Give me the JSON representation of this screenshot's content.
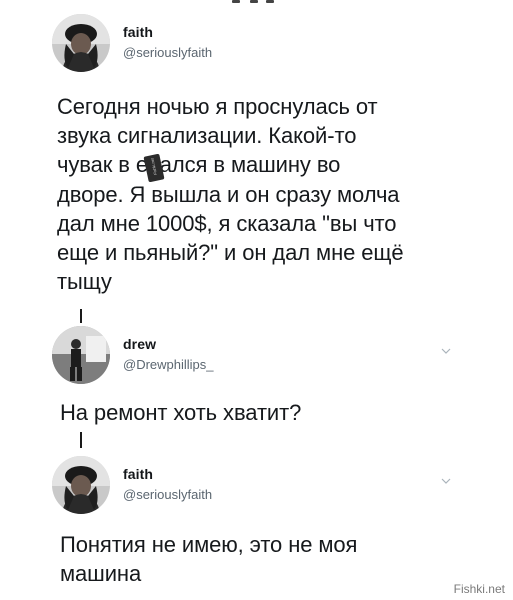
{
  "watermark": "Fishki.net",
  "censor_sticker": "Fishki.net",
  "tweets": [
    {
      "name": "faith",
      "handle": "@seriouslyfaith",
      "text": "Сегодня ночью я проснулась от\nзвука сигнализации. Какой-то\nчувак в ебался в машину во\nдворе. Я вышла и он сразу молча\nдал мне 1000$, я сказала \"вы что\nеще и пьяный?\" и он дал мне ещё\nтыщу"
    },
    {
      "name": "drew",
      "handle": "@Drewphillips_",
      "text": "На ремонт хоть хватит?"
    },
    {
      "name": "faith",
      "handle": "@seriouslyfaith",
      "text": "Понятия не имею, это не моя\nмашина"
    }
  ]
}
